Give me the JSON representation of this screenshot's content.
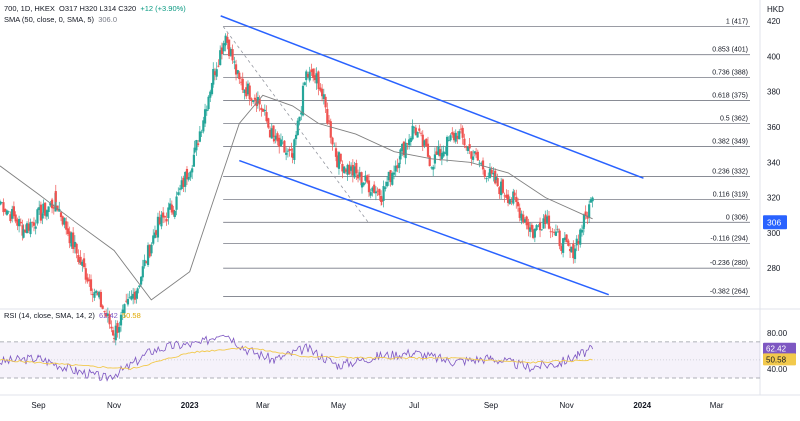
{
  "header": {
    "symbol_line": "700, 1D, HKEX",
    "ohlc": "O317  H320  L314  C320",
    "change": "+12 (+3.90%)",
    "sma_label": "SMA (50, close, 0, SMA, 5)",
    "sma_value": "306.0",
    "currency": "HKD"
  },
  "rsi_header": {
    "label": "RSI (14, close, SMA, 14, 2)",
    "rsi_value": "62.42",
    "sma_value": "50.58"
  },
  "colors": {
    "up": "#26a69a",
    "down": "#ef5350",
    "channel": "#2962ff",
    "fib": "#787b86",
    "sma": "#808080",
    "rsi": "#7e57c2",
    "rsi_sma": "#f2c94c",
    "price_badge": "#2962ff"
  },
  "chart_data": [
    {
      "type": "candlestick",
      "title": "700, 1D, HKEX",
      "y_axis": {
        "label": "HKD",
        "ticks": [
          280,
          300,
          320,
          340,
          360,
          380,
          400,
          420
        ],
        "range": [
          258,
          432
        ]
      },
      "x_axis": {
        "ticks": [
          "Sep",
          "Nov",
          "2023",
          "Mar",
          "May",
          "Jul",
          "Sep",
          "Nov",
          "2024",
          "Mar"
        ],
        "tick_dates": [
          "2022-09-01",
          "2022-11-01",
          "2023-01-01",
          "2023-03-01",
          "2023-05-01",
          "2023-07-01",
          "2023-09-01",
          "2023-11-01",
          "2024-01-01",
          "2024-03-01"
        ],
        "range": [
          "2022-08-01",
          "2024-04-05"
        ]
      },
      "last_price_badge": "306",
      "price_anchors": [
        [
          "2022-08-01",
          318
        ],
        [
          "2022-08-20",
          302
        ],
        [
          "2022-09-05",
          312
        ],
        [
          "2022-09-15",
          318
        ],
        [
          "2022-10-05",
          283
        ],
        [
          "2022-10-20",
          262
        ],
        [
          "2022-11-01",
          243
        ],
        [
          "2022-11-20",
          270
        ],
        [
          "2022-12-05",
          303
        ],
        [
          "2022-12-20",
          316
        ],
        [
          "2023-01-05",
          345
        ],
        [
          "2023-01-20",
          390
        ],
        [
          "2023-01-30",
          412
        ],
        [
          "2023-02-10",
          385
        ],
        [
          "2023-02-25",
          376
        ],
        [
          "2023-03-10",
          352
        ],
        [
          "2023-03-25",
          342
        ],
        [
          "2023-04-05",
          390
        ],
        [
          "2023-04-15",
          386
        ],
        [
          "2023-04-30",
          342
        ],
        [
          "2023-05-20",
          330
        ],
        [
          "2023-06-05",
          322
        ],
        [
          "2023-06-20",
          345
        ],
        [
          "2023-07-01",
          360
        ],
        [
          "2023-07-15",
          340
        ],
        [
          "2023-08-05",
          357
        ],
        [
          "2023-08-20",
          342
        ],
        [
          "2023-09-05",
          328
        ],
        [
          "2023-09-20",
          318
        ],
        [
          "2023-10-05",
          300
        ],
        [
          "2023-10-15",
          310
        ],
        [
          "2023-10-25",
          297
        ],
        [
          "2023-11-05",
          288
        ],
        [
          "2023-11-15",
          306
        ],
        [
          "2023-11-22",
          320
        ]
      ],
      "sma50": [
        [
          "2022-08-01",
          338
        ],
        [
          "2022-09-01",
          322
        ],
        [
          "2022-10-01",
          306
        ],
        [
          "2022-11-01",
          290
        ],
        [
          "2022-12-01",
          262
        ],
        [
          "2023-01-01",
          278
        ],
        [
          "2023-01-20",
          318
        ],
        [
          "2023-02-10",
          362
        ],
        [
          "2023-03-01",
          378
        ],
        [
          "2023-03-25",
          372
        ],
        [
          "2023-04-15",
          362
        ],
        [
          "2023-05-15",
          356
        ],
        [
          "2023-06-15",
          346
        ],
        [
          "2023-07-15",
          342
        ],
        [
          "2023-08-15",
          340
        ],
        [
          "2023-09-15",
          334
        ],
        [
          "2023-10-15",
          320
        ],
        [
          "2023-11-22",
          308
        ]
      ],
      "fib_levels": [
        {
          "label": "1 (417)",
          "value": 417
        },
        {
          "label": "0.853 (401)",
          "value": 401
        },
        {
          "label": "0.736 (388)",
          "value": 388
        },
        {
          "label": "0.618 (375)",
          "value": 375
        },
        {
          "label": "0.5 (362)",
          "value": 362
        },
        {
          "label": "0.382 (349)",
          "value": 349
        },
        {
          "label": "0.236 (332)",
          "value": 332
        },
        {
          "label": "0.116 (319)",
          "value": 319
        },
        {
          "label": "0 (306)",
          "value": 306
        },
        {
          "label": "-0.116 (294)",
          "value": 294
        },
        {
          "label": "-0.236 (280)",
          "value": 280
        },
        {
          "label": "-0.382 (264)",
          "value": 264
        }
      ],
      "channel_lines": [
        {
          "from": [
            "2023-01-26",
            423
          ],
          "to": [
            "2024-01-02",
            331
          ]
        },
        {
          "from": [
            "2023-02-10",
            341
          ],
          "to": [
            "2023-12-05",
            265
          ]
        }
      ],
      "dashed_line": {
        "from": [
          "2023-01-28",
          417
        ],
        "to": [
          "2023-05-25",
          306
        ]
      }
    },
    {
      "type": "line",
      "title": "RSI (14, close, SMA, 14, 2)",
      "y_axis": {
        "ticks": [
          80,
          40
        ],
        "range": [
          20,
          92
        ]
      },
      "bands": [
        70,
        30
      ],
      "last_values": [
        "62.42",
        "50.58"
      ],
      "rsi_anchors": [
        [
          "2022-08-01",
          48
        ],
        [
          "2022-09-01",
          52
        ],
        [
          "2022-10-01",
          38
        ],
        [
          "2022-10-25",
          30
        ],
        [
          "2022-11-10",
          40
        ],
        [
          "2022-12-01",
          60
        ],
        [
          "2022-12-20",
          66
        ],
        [
          "2023-01-10",
          68
        ],
        [
          "2023-01-28",
          82
        ],
        [
          "2023-02-15",
          62
        ],
        [
          "2023-03-10",
          50
        ],
        [
          "2023-04-05",
          63
        ],
        [
          "2023-05-01",
          44
        ],
        [
          "2023-06-01",
          54
        ],
        [
          "2023-07-01",
          58
        ],
        [
          "2023-08-01",
          48
        ],
        [
          "2023-09-01",
          52
        ],
        [
          "2023-10-01",
          42
        ],
        [
          "2023-10-25",
          46
        ],
        [
          "2023-11-10",
          55
        ],
        [
          "2023-11-22",
          62
        ]
      ],
      "sma_anchors": [
        [
          "2022-08-01",
          50
        ],
        [
          "2022-10-01",
          44
        ],
        [
          "2022-11-15",
          40
        ],
        [
          "2023-01-01",
          58
        ],
        [
          "2023-02-15",
          64
        ],
        [
          "2023-04-01",
          54
        ],
        [
          "2023-06-01",
          52
        ],
        [
          "2023-08-01",
          52
        ],
        [
          "2023-10-01",
          47
        ],
        [
          "2023-11-22",
          50
        ]
      ]
    }
  ]
}
